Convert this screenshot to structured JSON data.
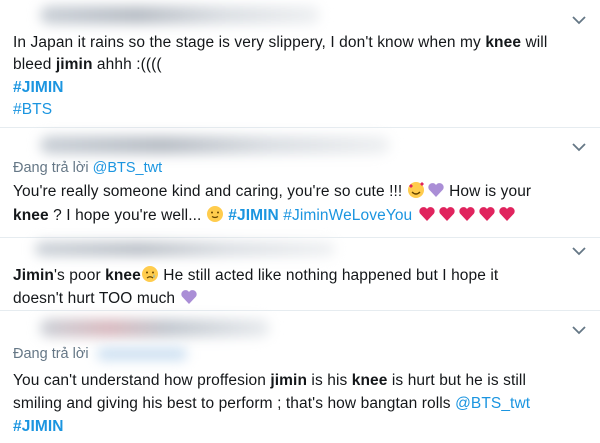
{
  "colors": {
    "link": "#1b95e0",
    "muted": "#657786",
    "heart": "#e0245e",
    "purple_heart": "#aa8ed6"
  },
  "tweets": [
    {
      "lines": [
        {
          "a": "In Japan it rains so the stage is very slippery, I don't know when my ",
          "b": "knee",
          "c": " will"
        },
        {
          "a": "bleed ",
          "b": "jimin",
          "c": " ahhh :(((("
        }
      ],
      "hashtag1": "#JIMIN",
      "hashtag2": "#BTS"
    },
    {
      "reply_label": "Đang trả lời",
      "reply_handle": "@BTS_twt",
      "line1": "You're really someone kind and caring, you're so cute !!! ",
      "line1_end": " How is your",
      "line2_a": "knee",
      "line2_b": " ? I hope you're well... ",
      "hashtag1": "#JIMIN",
      "hashtag2": "#JiminWeLoveYou",
      "emojis": [
        "smiling-face-with-hearts-icon",
        "purple-heart-icon",
        "hugging-face-icon",
        "red-heart-icon"
      ]
    },
    {
      "line1_a": "Jimin",
      "line1_b": "'s poor ",
      "line1_c": "knee",
      "line1_d": " He still acted like nothing happened but I hope it",
      "line2": "doesn't hurt TOO much "
    },
    {
      "reply_label": "Đang trả lời",
      "line1_a": "You can't understand how proffesion ",
      "line1_b": "jimin",
      "line1_c": " is his ",
      "line1_d": "knee",
      "line1_e": " is hurt but he is still",
      "line2_a": "smiling and giving his best to perform ; that's how bangtan rolls ",
      "line2_handle": "@BTS_twt",
      "hashtag": "#JIMIN"
    }
  ]
}
